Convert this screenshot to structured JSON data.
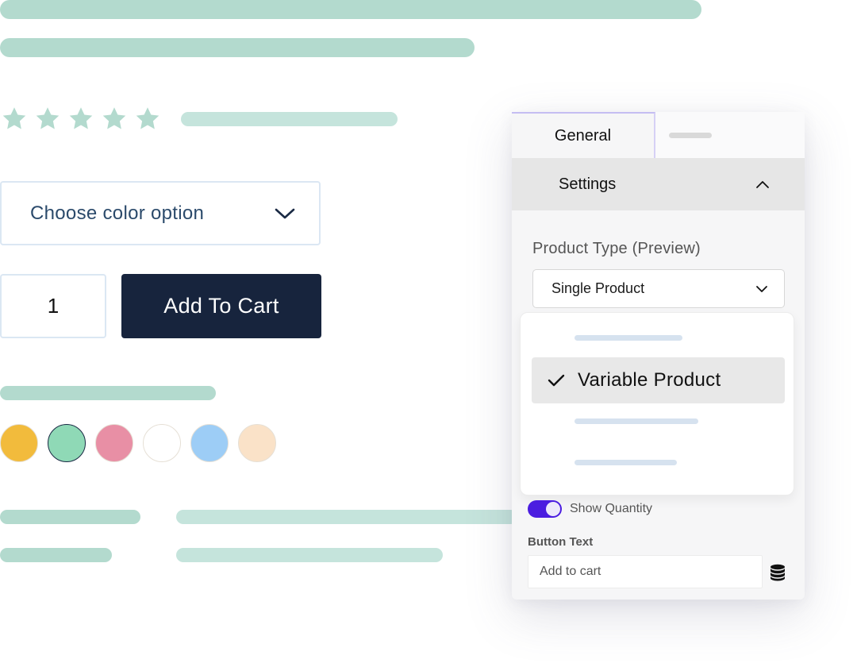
{
  "product_preview": {
    "rating": {
      "stars_filled": 5,
      "stars_total": 5
    },
    "color_select": {
      "placeholder": "Choose color option"
    },
    "quantity": {
      "value": "1"
    },
    "add_to_cart_label": "Add To Cart",
    "swatches": [
      {
        "name": "yellow",
        "color": "#f2bb3c",
        "selected": false
      },
      {
        "name": "green",
        "color": "#8fd9b6",
        "selected": true
      },
      {
        "name": "pink",
        "color": "#e88fa5",
        "selected": false
      },
      {
        "name": "white",
        "color": "#ffffff",
        "selected": false
      },
      {
        "name": "blue",
        "color": "#9dcdf6",
        "selected": false
      },
      {
        "name": "peach",
        "color": "#fae2c8",
        "selected": false
      }
    ],
    "placeholder_color": "#b3dace"
  },
  "panel": {
    "tabs": [
      {
        "label": "General",
        "active": true
      },
      {
        "label": "",
        "active": false
      }
    ],
    "section": {
      "title": "Settings",
      "expanded": true
    },
    "product_type": {
      "label": "Product Type (Preview)",
      "value": "Single Product",
      "options_open": true,
      "highlighted_option": "Variable Product"
    },
    "show_quantity": {
      "label": "Show Quantity",
      "enabled": true,
      "accent": "#4b1de0"
    },
    "button_text": {
      "label": "Button Text",
      "value": "Add to cart"
    }
  }
}
